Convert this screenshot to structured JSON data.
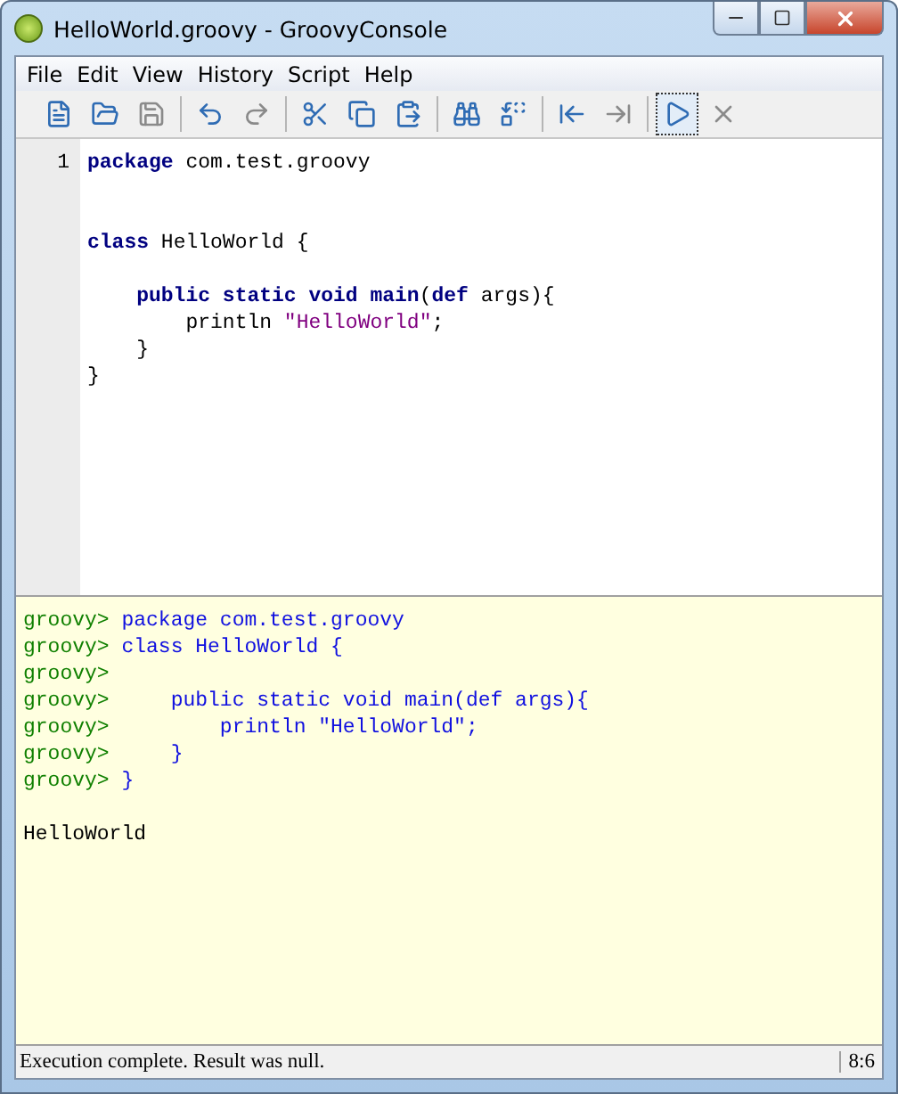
{
  "window": {
    "title": "HelloWorld.groovy - GroovyConsole"
  },
  "menu": [
    "File",
    "Edit",
    "View",
    "History",
    "Script",
    "Help"
  ],
  "toolbar": [
    {
      "kind": "new",
      "disabled": false,
      "selected": false
    },
    {
      "kind": "open",
      "disabled": false,
      "selected": false
    },
    {
      "kind": "save",
      "disabled": true,
      "selected": false
    },
    {
      "kind": "separator"
    },
    {
      "kind": "undo",
      "disabled": false,
      "selected": false
    },
    {
      "kind": "redo",
      "disabled": true,
      "selected": false
    },
    {
      "kind": "separator"
    },
    {
      "kind": "cut",
      "disabled": false,
      "selected": false
    },
    {
      "kind": "copy",
      "disabled": false,
      "selected": false
    },
    {
      "kind": "paste",
      "disabled": false,
      "selected": false
    },
    {
      "kind": "separator"
    },
    {
      "kind": "find",
      "disabled": false,
      "selected": false
    },
    {
      "kind": "replace",
      "disabled": false,
      "selected": false
    },
    {
      "kind": "separator"
    },
    {
      "kind": "previous",
      "disabled": false,
      "selected": false
    },
    {
      "kind": "next",
      "disabled": true,
      "selected": false
    },
    {
      "kind": "separator"
    },
    {
      "kind": "run",
      "disabled": false,
      "selected": true
    },
    {
      "kind": "interrupt",
      "disabled": true,
      "selected": false
    }
  ],
  "editor": {
    "line_number": "1",
    "lines": [
      {
        "kind": "code",
        "tokens": [
          {
            "kind": "keyword",
            "text": "package"
          },
          {
            "kind": "plain",
            "text": " com.test.groovy"
          }
        ]
      },
      {
        "kind": "blank"
      },
      {
        "kind": "blank"
      },
      {
        "kind": "code",
        "tokens": [
          {
            "kind": "keyword",
            "text": "class"
          },
          {
            "kind": "plain",
            "text": " HelloWorld {"
          }
        ]
      },
      {
        "kind": "blank"
      },
      {
        "kind": "code",
        "tokens": [
          {
            "kind": "keyword",
            "text": "    public static void main"
          },
          {
            "kind": "plain",
            "text": "("
          },
          {
            "kind": "keyword",
            "text": "def"
          },
          {
            "kind": "plain",
            "text": " args){"
          }
        ]
      },
      {
        "kind": "code",
        "tokens": [
          {
            "kind": "plain",
            "text": "        println "
          },
          {
            "kind": "string",
            "text": "\"HelloWorld\""
          },
          {
            "kind": "plain",
            "text": ";"
          }
        ]
      },
      {
        "kind": "code",
        "tokens": [
          {
            "kind": "plain",
            "text": "    }"
          }
        ]
      },
      {
        "kind": "code",
        "tokens": [
          {
            "kind": "plain",
            "text": "}"
          }
        ]
      }
    ]
  },
  "output": {
    "lines": [
      {
        "kind": "input",
        "prompt": "groovy>",
        "code": " package com.test.groovy"
      },
      {
        "kind": "input",
        "prompt": "groovy>",
        "code": " class HelloWorld {"
      },
      {
        "kind": "input",
        "prompt": "groovy>"
      },
      {
        "kind": "input",
        "prompt": "groovy>",
        "code": "     public static void main(def args){"
      },
      {
        "kind": "input",
        "prompt": "groovy>",
        "code": "         println \"HelloWorld\";"
      },
      {
        "kind": "input",
        "prompt": "groovy>",
        "code": "     }"
      },
      {
        "kind": "input",
        "prompt": "groovy>",
        "code": " }"
      },
      {
        "kind": "blank"
      },
      {
        "kind": "result",
        "text": "HelloWorld"
      }
    ]
  },
  "status_bar": {
    "message": "Execution complete. Result was null.",
    "position": "8:6"
  }
}
